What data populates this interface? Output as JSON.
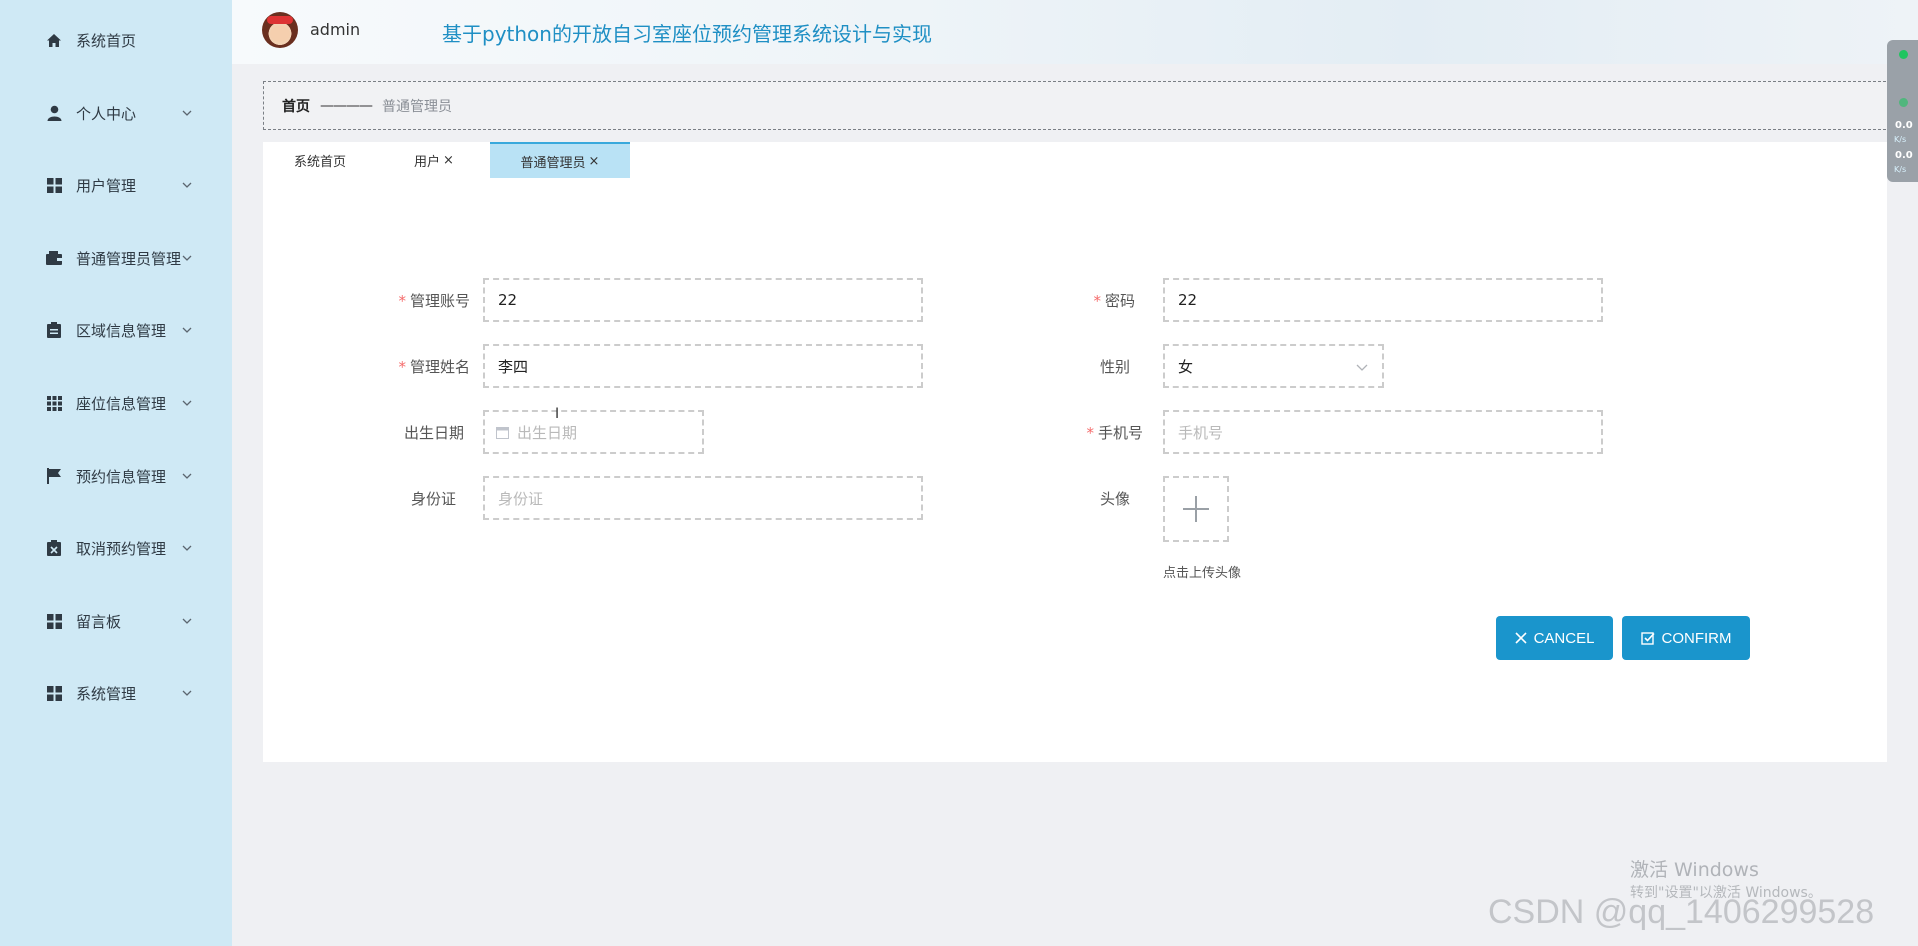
{
  "sidebar": {
    "items": [
      {
        "label": "系统首页",
        "icon": "home-icon",
        "has_submenu": false
      },
      {
        "label": "个人中心",
        "icon": "user-icon",
        "has_submenu": true
      },
      {
        "label": "用户管理",
        "icon": "grid-icon",
        "has_submenu": true
      },
      {
        "label": "普通管理员管理",
        "icon": "wallet-icon",
        "has_submenu": true
      },
      {
        "label": "区域信息管理",
        "icon": "clipboard-icon",
        "has_submenu": true
      },
      {
        "label": "座位信息管理",
        "icon": "apps-icon",
        "has_submenu": true
      },
      {
        "label": "预约信息管理",
        "icon": "flag-icon",
        "has_submenu": true
      },
      {
        "label": "取消预约管理",
        "icon": "cancel-clipboard-icon",
        "has_submenu": true
      },
      {
        "label": "留言板",
        "icon": "grid-icon",
        "has_submenu": true
      },
      {
        "label": "系统管理",
        "icon": "grid-icon",
        "has_submenu": true
      }
    ]
  },
  "header": {
    "username": "admin",
    "title": "基于python的开放自习室座位预约管理系统设计与实现"
  },
  "breadcrumb": {
    "home": "首页",
    "separator": "————",
    "current": "普通管理员"
  },
  "tabs": [
    {
      "label": "系统首页",
      "closable": false,
      "active": false
    },
    {
      "label": "用户",
      "closable": true,
      "active": false
    },
    {
      "label": "普通管理员",
      "closable": true,
      "active": true
    }
  ],
  "tab_close_glyph": "×",
  "form": {
    "account": {
      "label": "管理账号",
      "required": true,
      "value": "22"
    },
    "password": {
      "label": "密码",
      "required": true,
      "value": "22"
    },
    "name": {
      "label": "管理姓名",
      "required": true,
      "value": "李四"
    },
    "gender": {
      "label": "性别",
      "required": false,
      "value": "女"
    },
    "birthday": {
      "label": "出生日期",
      "required": false,
      "value": "",
      "placeholder": "出生日期"
    },
    "phone": {
      "label": "手机号",
      "required": true,
      "value": "",
      "placeholder": "手机号"
    },
    "id_card": {
      "label": "身份证",
      "required": false,
      "value": "",
      "placeholder": "身份证"
    },
    "avatar": {
      "label": "头像",
      "required": false,
      "upload_hint": "点击上传头像"
    }
  },
  "required_mark": "*",
  "buttons": {
    "cancel": "CANCEL",
    "confirm": "CONFIRM"
  },
  "net_widget": {
    "upload": "0.0",
    "upload_unit": "K/s",
    "download": "0.0",
    "download_unit": "K/s"
  },
  "watermarks": {
    "windows_line1": "激活 Windows",
    "windows_line2": "转到\"设置\"以激活 Windows。",
    "csdn": "CSDN @qq_1406299528"
  },
  "colors": {
    "sidebar_bg": "#cfe9f5",
    "accent": "#1a95cc",
    "title": "#1f8fc4",
    "required": "#f56c6c",
    "active_tab": "#b9e2f5"
  }
}
